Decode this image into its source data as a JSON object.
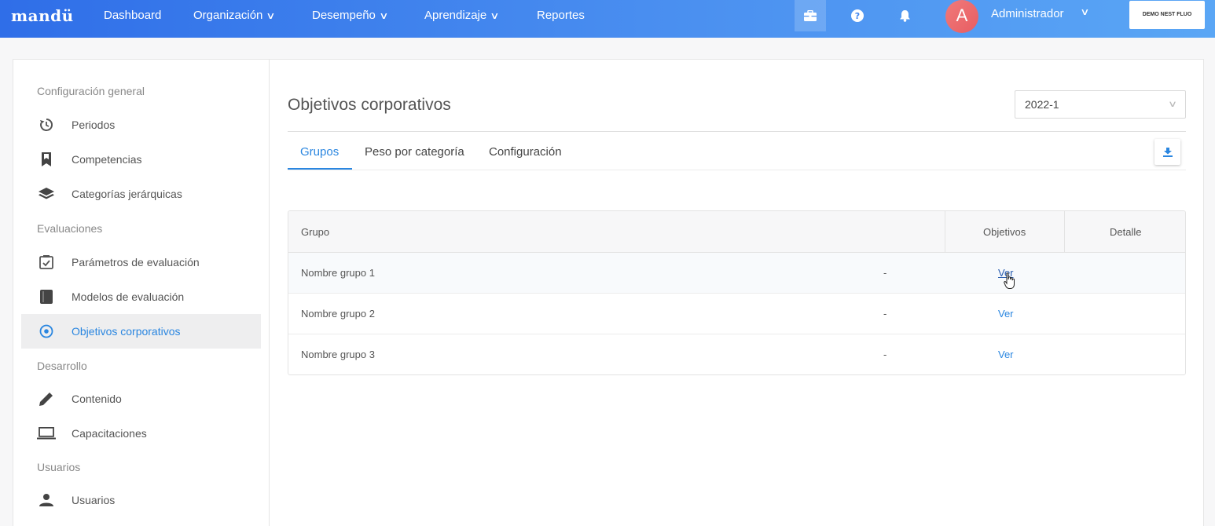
{
  "topbar": {
    "brand": "mandü",
    "nav": [
      {
        "label": "Dashboard"
      },
      {
        "label": "Organización"
      },
      {
        "label": "Desempeño"
      },
      {
        "label": "Aprendizaje"
      },
      {
        "label": "Reportes"
      }
    ],
    "icons": [
      "briefcase-icon",
      "help-icon",
      "bell-icon"
    ],
    "avatar_letter": "A",
    "user_name": "Administrador",
    "company": "DEMO NEST FLUO"
  },
  "sidebar": {
    "sections": [
      {
        "title": "Configuración general",
        "items": [
          {
            "label": "Periodos",
            "icon": "history-icon"
          },
          {
            "label": "Competencias",
            "icon": "bookmark-icon"
          },
          {
            "label": "Categorías jerárquicas",
            "icon": "layers-icon"
          }
        ]
      },
      {
        "title": "Evaluaciones",
        "items": [
          {
            "label": "Parámetros de evaluación",
            "icon": "checkbox-icon"
          },
          {
            "label": "Modelos de evaluación",
            "icon": "book-icon"
          },
          {
            "label": "Objetivos corporativos",
            "icon": "target-icon",
            "active": true
          }
        ]
      },
      {
        "title": "Desarrollo",
        "items": [
          {
            "label": "Contenido",
            "icon": "pencil-icon"
          },
          {
            "label": "Capacitaciones",
            "icon": "laptop-icon"
          }
        ]
      },
      {
        "title": "Usuarios",
        "items": [
          {
            "label": "Usuarios",
            "icon": "user-icon"
          }
        ]
      }
    ]
  },
  "main": {
    "title": "Objetivos corporativos",
    "period": "2022-1",
    "tabs": [
      {
        "label": "Grupos",
        "active": true
      },
      {
        "label": "Peso por categoría"
      },
      {
        "label": "Configuración"
      }
    ],
    "table": {
      "headers": [
        "Grupo",
        "Objetivos",
        "Detalle"
      ],
      "rows": [
        {
          "grupo": "Nombre grupo 1",
          "dash": "-",
          "objetivos": "Ver"
        },
        {
          "grupo": "Nombre grupo 2",
          "dash": "-",
          "objetivos": "Ver"
        },
        {
          "grupo": "Nombre grupo 3",
          "dash": "-",
          "objetivos": "Ver"
        }
      ]
    }
  },
  "colors": {
    "accent": "#2a86e0",
    "topbar_start": "#2f6ee8",
    "topbar_end": "#5aa6f5",
    "active_bg": "#eeeeef"
  }
}
